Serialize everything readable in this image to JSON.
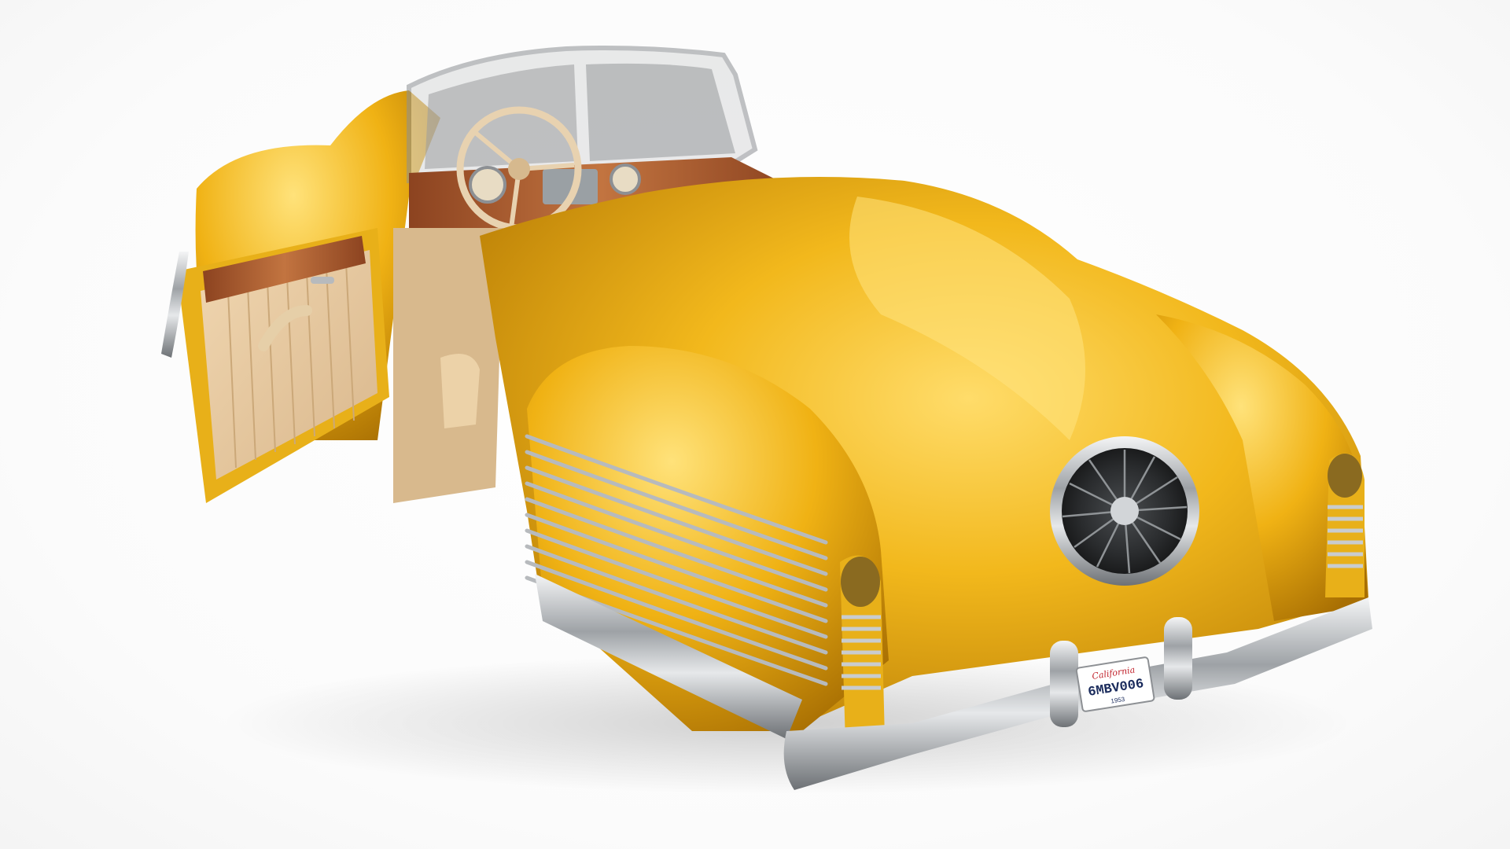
{
  "scene": {
    "subject": "yellow vintage roadster",
    "palette": {
      "body": "#f2b81c",
      "body_dark": "#c98a07",
      "body_light": "#ffd862",
      "chrome": "#b9bcbf",
      "wood": "#a8582e",
      "interior": "#e7c9a0",
      "background": "#ffffff"
    }
  },
  "license_plate": {
    "state": "California",
    "number": "6MBV006",
    "year": "1953"
  }
}
